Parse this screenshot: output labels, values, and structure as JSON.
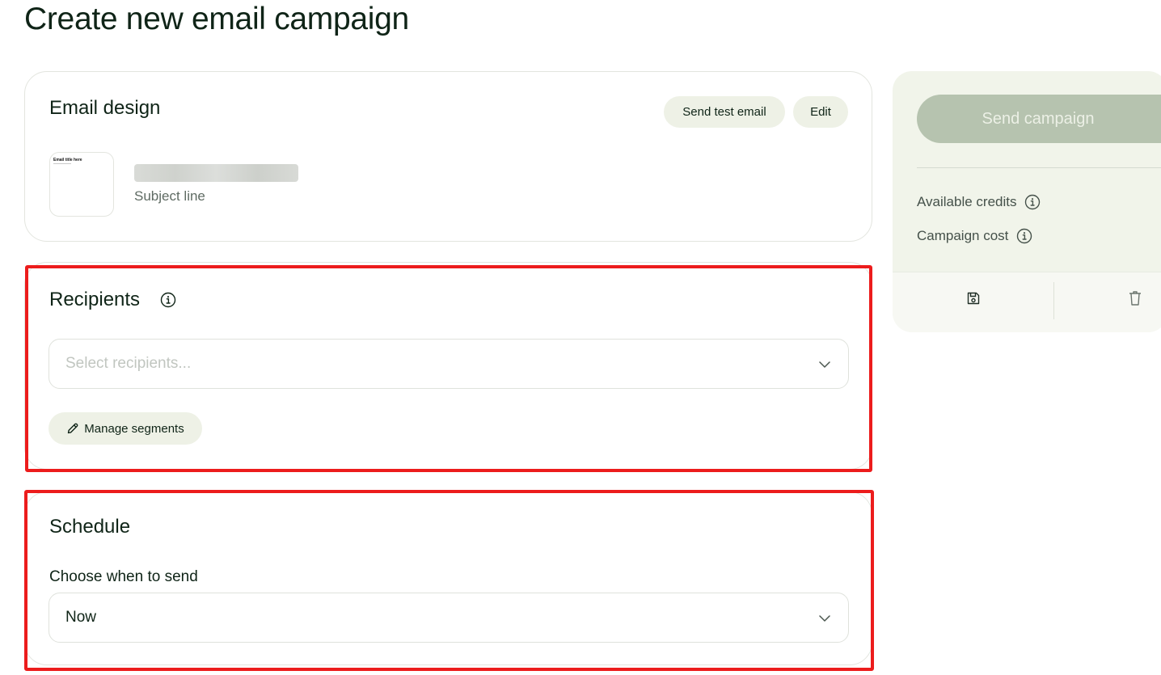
{
  "page": {
    "title": "Create new email campaign"
  },
  "email_design": {
    "title": "Email design",
    "send_test_label": "Send test email",
    "edit_label": "Edit",
    "thumbnail_title": "Email title here",
    "subject_label": "Subject line"
  },
  "recipients": {
    "title": "Recipients",
    "select_placeholder": "Select recipients...",
    "manage_segments_label": "Manage segments"
  },
  "schedule": {
    "title": "Schedule",
    "field_label": "Choose when to send",
    "selected_value": "Now"
  },
  "side_panel": {
    "send_label": "Send campaign",
    "available_credits_label": "Available credits",
    "campaign_cost_label": "Campaign cost"
  },
  "icons": {
    "info": "info-icon",
    "chevron": "chevron-down-icon",
    "pencil": "pencil-icon",
    "save": "save-icon",
    "trash": "trash-icon"
  },
  "colors": {
    "text": "#0f2417",
    "pill_bg": "#eef1e6",
    "panel_bg": "#f1f4ea",
    "send_disabled": "#b6c3af",
    "highlight": "#ec1c1c"
  }
}
